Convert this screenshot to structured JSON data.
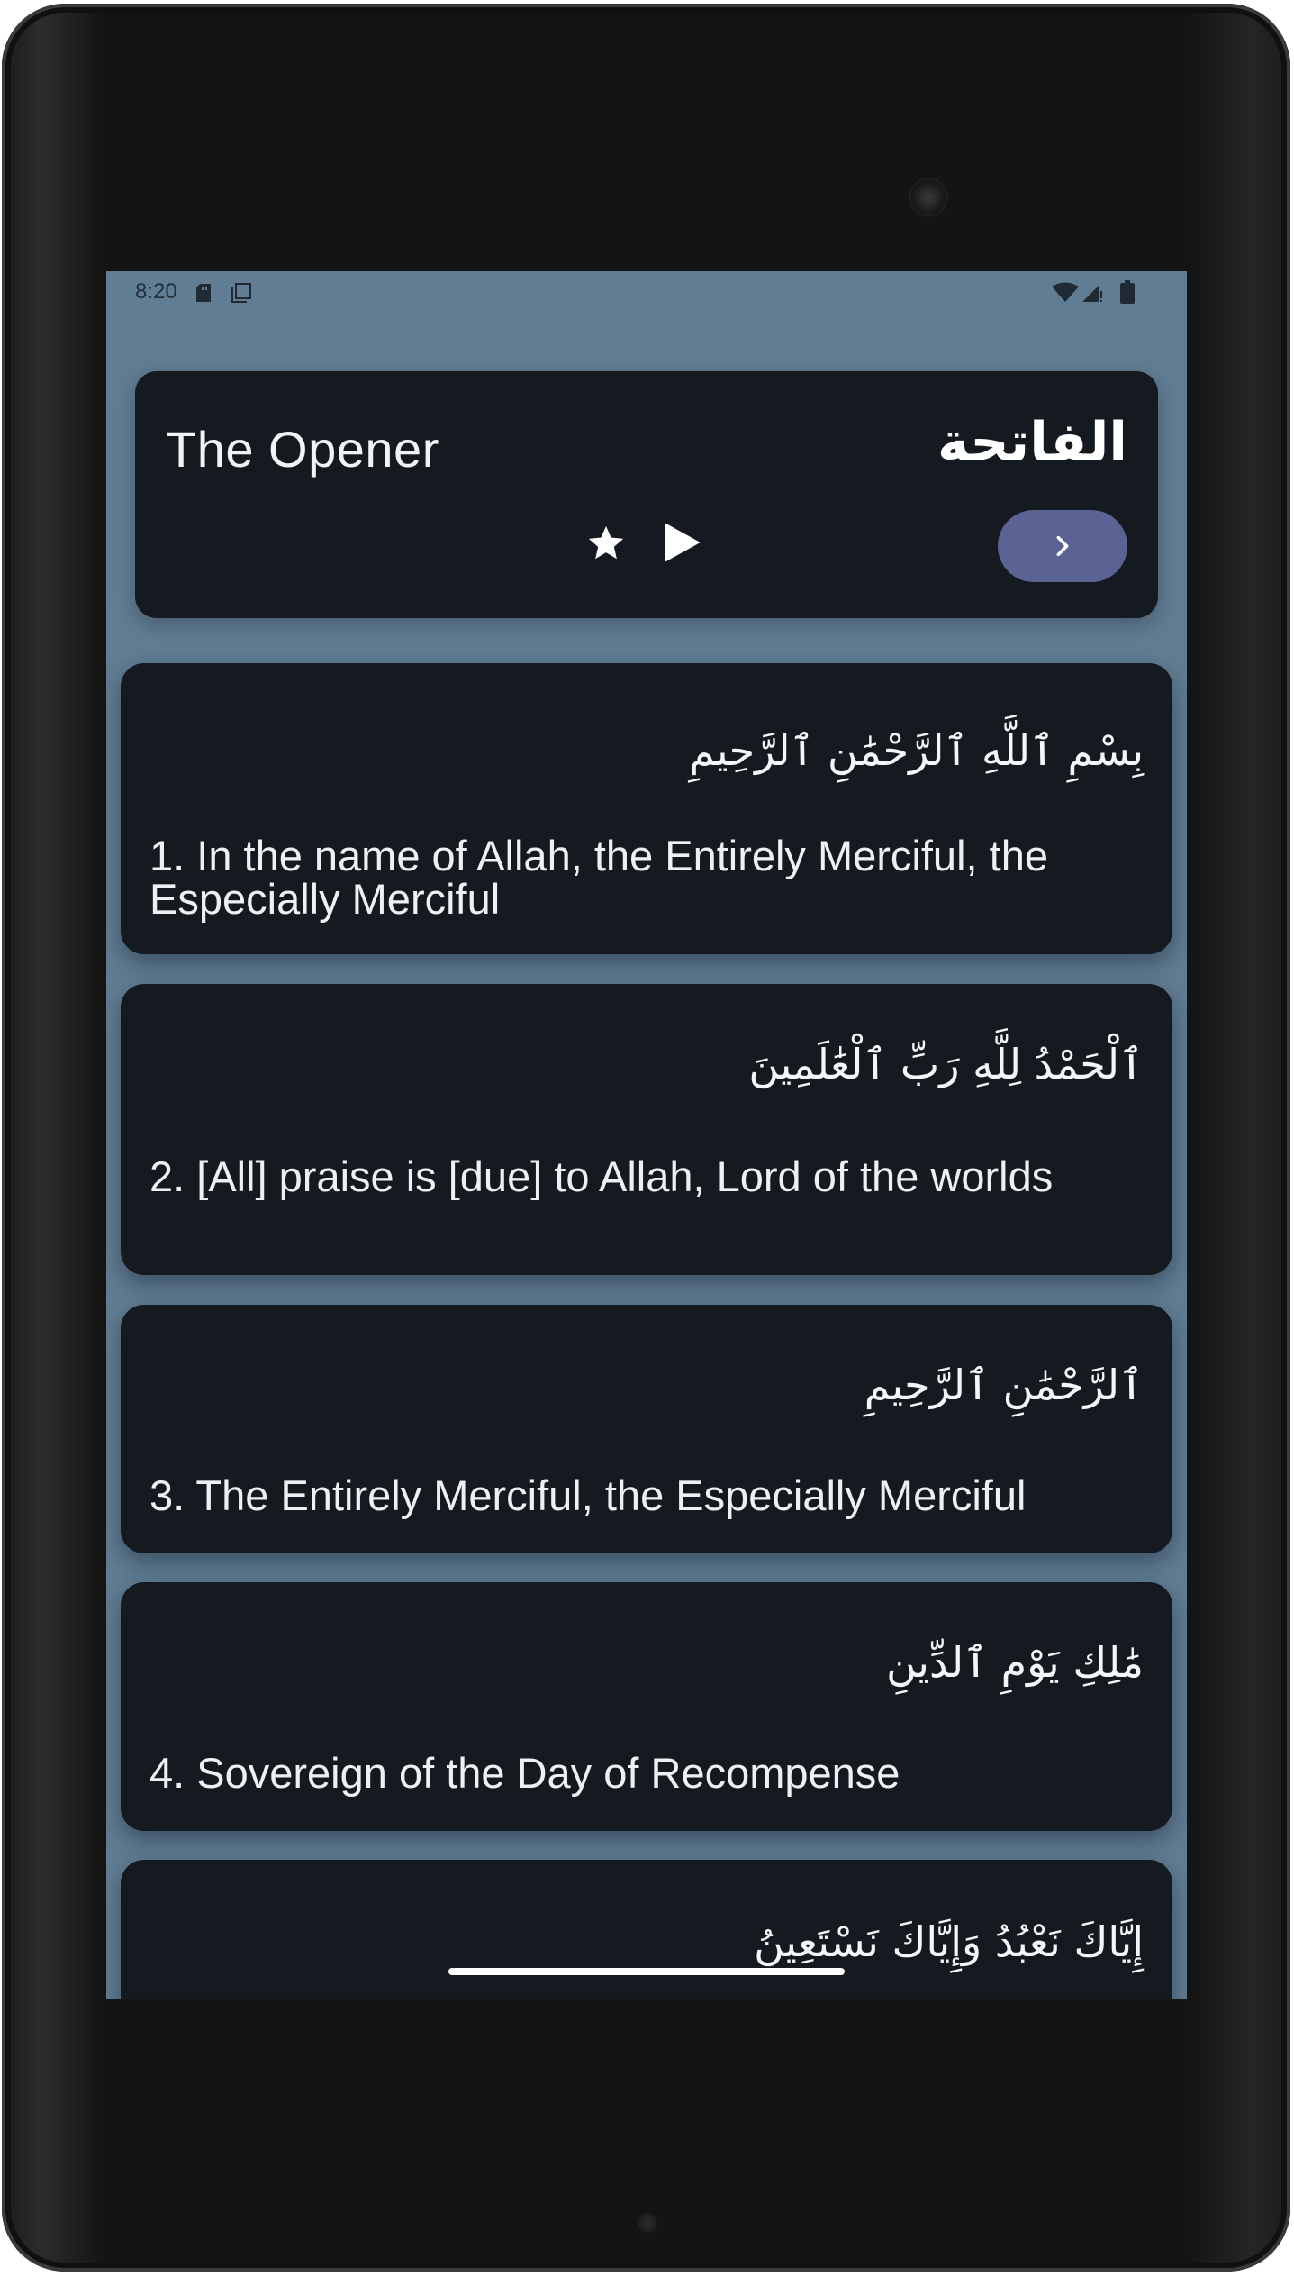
{
  "status_bar": {
    "time": "8:20",
    "icons": [
      "sd-card-icon",
      "copy-icon",
      "wifi-icon",
      "signal-icon",
      "battery-icon"
    ]
  },
  "surah": {
    "name_en": "The Opener",
    "name_ar": "الفاتحة",
    "actions": [
      "star-icon",
      "play-icon",
      "chevron-right-icon"
    ]
  },
  "ayahs": [
    {
      "arabic": "بِسْمِ ٱللَّهِ ٱلرَّحْمَٰنِ ٱلرَّحِيمِ",
      "translation": "1. In the name of Allah, the Entirely Merciful, the Especially Merciful"
    },
    {
      "arabic": "ٱلْحَمْدُ لِلَّهِ رَبِّ ٱلْعَٰلَمِينَ",
      "translation": "2. [All] praise is [due] to Allah, Lord of the worlds"
    },
    {
      "arabic": "ٱلرَّحْمَٰنِ ٱلرَّحِيمِ",
      "translation": "3. The Entirely Merciful, the Especially Merciful"
    },
    {
      "arabic": "مَٰلِكِ يَوْمِ ٱلدِّينِ",
      "translation": "4. Sovereign of the Day of Recompense"
    },
    {
      "arabic": "إِيَّاكَ نَعْبُدُ وَإِيَّاكَ نَسْتَعِينُ",
      "translation": ""
    }
  ],
  "colors": {
    "screen_background": "#617d93",
    "card_background": "#151a20",
    "accent_button": "#5b6395",
    "text": "#f1f3f5"
  }
}
